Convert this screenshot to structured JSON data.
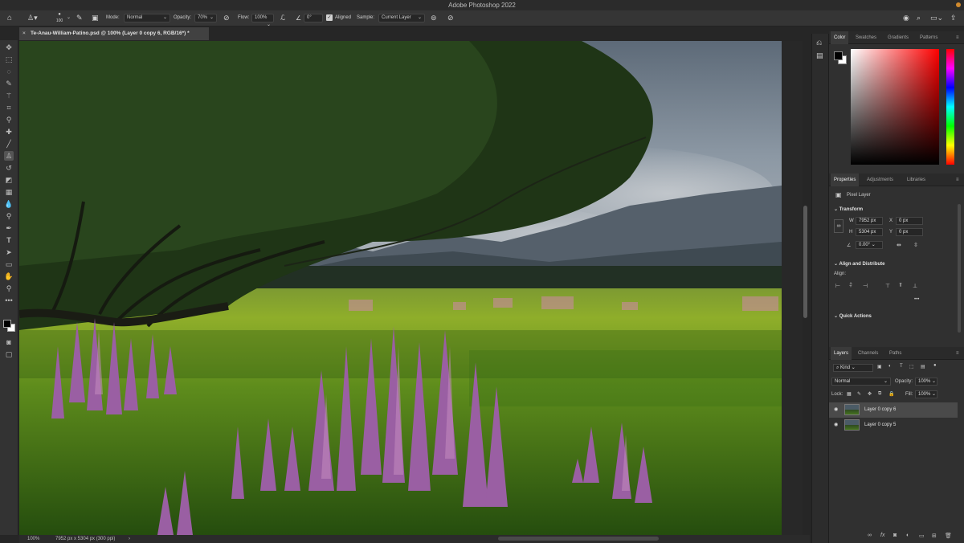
{
  "app": {
    "title": "Adobe Photoshop 2022"
  },
  "options_bar": {
    "brush_size": "100",
    "mode_label": "Mode:",
    "mode_value": "Normal",
    "opacity_label": "Opacity:",
    "opacity_value": "70%",
    "flow_label": "Flow:",
    "flow_value": "100%",
    "angle_value": "0°",
    "aligned_label": "Aligned",
    "sample_label": "Sample:",
    "sample_value": "Current Layer"
  },
  "document": {
    "tab_title": "Te-Anau-William-Patino.psd @ 100% (Layer 0 copy 6, RGB/16*) *"
  },
  "status": {
    "zoom": "100%",
    "dimensions": "7952 px x 5304 px (300 ppi)"
  },
  "color_panel": {
    "tabs": [
      "Color",
      "Swatches",
      "Gradients",
      "Patterns"
    ],
    "foreground": "#000000",
    "background": "#ffffff",
    "hue": "#ff0000"
  },
  "properties_panel": {
    "tabs": [
      "Properties",
      "Adjustments",
      "Libraries"
    ],
    "layer_type": "Pixel Layer",
    "transform_title": "Transform",
    "w_label": "W",
    "w_value": "7952 px",
    "h_label": "H",
    "h_value": "5304 px",
    "x_label": "X",
    "x_value": "0 px",
    "y_label": "Y",
    "y_value": "0 px",
    "angle_value": "0.00°",
    "align_title": "Align and Distribute",
    "align_label": "Align:",
    "more": "•••",
    "quick_actions_title": "Quick Actions"
  },
  "layers_panel": {
    "tabs": [
      "Layers",
      "Channels",
      "Paths"
    ],
    "filter_value": "Kind",
    "blend_mode": "Normal",
    "opacity_label": "Opacity:",
    "opacity_value": "100%",
    "lock_label": "Lock:",
    "fill_label": "Fill:",
    "fill_value": "100%",
    "layers": [
      {
        "name": "Layer 0 copy 6",
        "selected": true
      },
      {
        "name": "Layer 0 copy 5",
        "selected": false
      }
    ],
    "footer_fx": "fx"
  }
}
